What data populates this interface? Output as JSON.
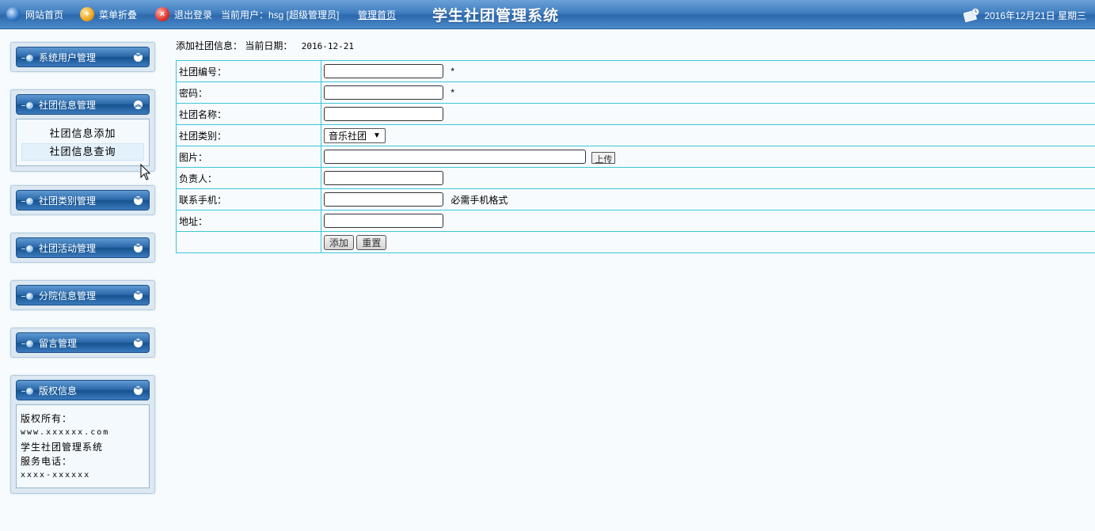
{
  "topbar": {
    "home_link": "网站首页",
    "collapse_menu": "菜单折叠",
    "logout": "退出登录",
    "current_user": "当前用户：hsg [超级管理员]",
    "admin_home": "管理首页",
    "system_title": "学生社团管理系统",
    "date_text": "2016年12月21日 星期三",
    "icons": [
      "globe-icon",
      "collapse-icon",
      "logout-icon",
      "calendar-icon"
    ]
  },
  "sidebar": {
    "panels": [
      {
        "title": "系统用户管理",
        "expanded": false
      },
      {
        "title": "社团信息管理",
        "expanded": true,
        "items": [
          "社团信息添加",
          "社团信息查询"
        ]
      },
      {
        "title": "社团类别管理",
        "expanded": false
      },
      {
        "title": "社团活动管理",
        "expanded": false
      },
      {
        "title": "分院信息管理",
        "expanded": false
      },
      {
        "title": "留言管理",
        "expanded": false
      },
      {
        "title": "版权信息",
        "expanded": true,
        "lines": [
          "版权所有：",
          "www.xxxxxx.com",
          "学生社团管理系统",
          "服务电话：",
          "xxxx-xxxxxx"
        ]
      }
    ]
  },
  "main": {
    "page_heading": "添加社团信息：",
    "date_label": "当前日期：",
    "date_value": "2016-12-21",
    "form": {
      "club_no_label": "社团编号：",
      "club_no_value": "",
      "password_label": "密码：",
      "password_value": "",
      "required_mark": "*",
      "club_name_label": "社团名称：",
      "club_name_value": "",
      "category_label": "社团类别：",
      "category_selected": "音乐社团",
      "photo_label": "图片：",
      "photo_value": "",
      "upload_button": "上传",
      "leader_label": "负责人：",
      "leader_value": "",
      "phone_label": "联系手机：",
      "phone_value": "",
      "phone_hint": "必需手机格式",
      "address_label": "地址：",
      "address_value": "",
      "add_button": "添加",
      "reset_button": "重置"
    }
  },
  "colors": {
    "topbar": "#3f7dc0",
    "table_border": "#3cc7d6",
    "page_bg": "#f7fbfe"
  }
}
